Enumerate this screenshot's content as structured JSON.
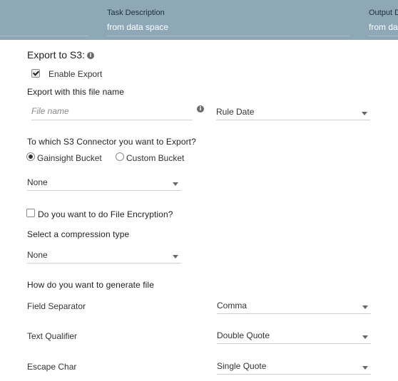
{
  "header": {
    "columns": [
      {
        "heading": "",
        "value": ""
      },
      {
        "heading": "Task Description",
        "value": "from data space"
      },
      {
        "heading": "Output D",
        "value": "from da"
      }
    ]
  },
  "export": {
    "title": "Export to S3:",
    "info_icon": "info-icon",
    "enable_label": "Enable Export",
    "enable_checked": true,
    "file_name_heading": "Export with this file name",
    "file_name_placeholder": "File name",
    "file_name_value": "",
    "date_select_value": "Rule Date",
    "connector_question": "To which S3 Connector you want to Export?",
    "connector_options": [
      {
        "label": "Gainsight Bucket",
        "selected": true
      },
      {
        "label": "Custom Bucket",
        "selected": false
      }
    ],
    "connector_select_value": "None",
    "encryption_label": "Do you want to do File Encryption?",
    "encryption_checked": false,
    "compression_heading": "Select a compression type",
    "compression_value": "None",
    "generate_heading": "How do you want to generate file",
    "fields": [
      {
        "label": "Field Separator",
        "value": "Comma"
      },
      {
        "label": "Text Qualifier",
        "value": "Double Quote"
      },
      {
        "label": "Escape Char",
        "value": "Single Quote"
      }
    ]
  }
}
